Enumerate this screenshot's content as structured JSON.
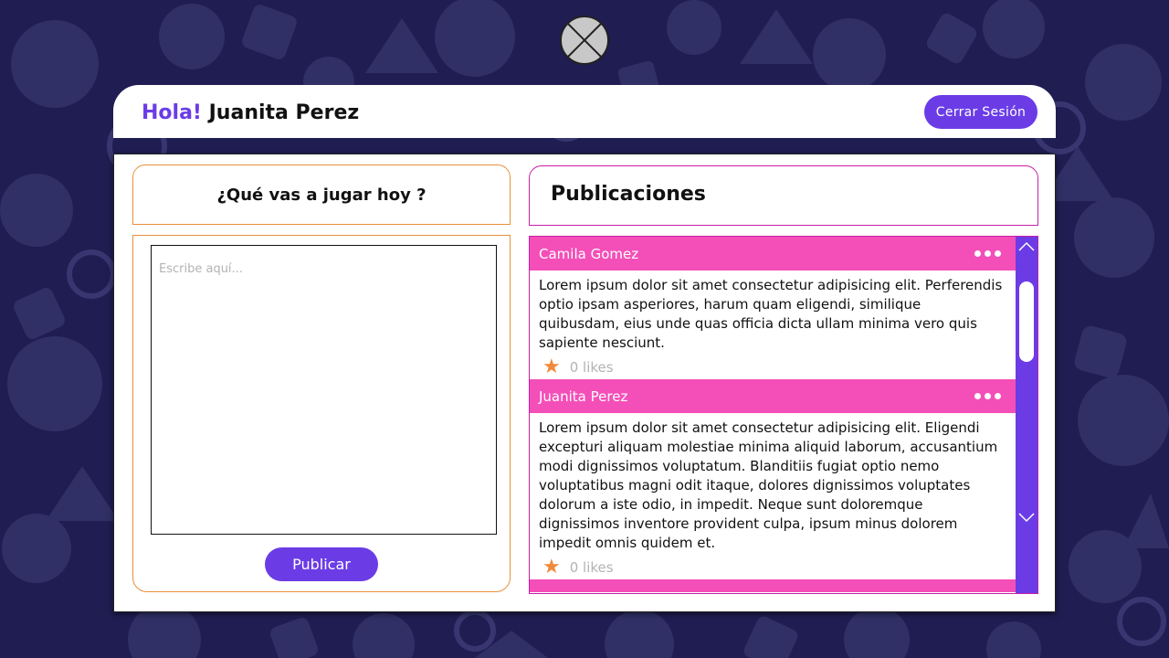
{
  "header": {
    "greeting": "Hola!",
    "user_name": "Juanita Perez",
    "logout_label": "Cerrar Sesión"
  },
  "composer": {
    "question": "¿Qué vas a jugar hoy ?",
    "placeholder": "Escribe aquí...",
    "publish_label": "Publicar"
  },
  "feed": {
    "title": "Publicaciones",
    "posts": [
      {
        "author": "Camila Gomez",
        "text": "Lorem ipsum dolor sit amet consectetur adipisicing elit. Perferendis optio ipsam asperiores, harum quam eligendi, similique quibusdam, eius unde quas officia dicta ullam minima vero quis sapiente nesciunt.",
        "likes": "0 likes"
      },
      {
        "author": "Juanita Perez",
        "text": "Lorem ipsum dolor sit amet consectetur adipisicing elit. Eligendi excepturi aliquam molestiae minima aliquid laborum, accusantium modi dignissimos voluptatum. Blanditiis fugiat optio nemo voluptatibus magni odit itaque, dolores dignissimos voluptates dolorum a iste odio, in impedit. Neque sunt doloremque dignissimos inventore provident culpa, ipsum minus dolorem impedit omnis quidem et.",
        "likes": "0 likes"
      }
    ]
  },
  "colors": {
    "accent_purple": "#6b3ce6",
    "post_pink": "#f44fb8",
    "border_orange": "#e8913c",
    "border_magenta": "#c51fa6",
    "background": "#1f1d52",
    "star": "#f2883a"
  },
  "icons": {
    "logo": "x-circle-logo-icon",
    "post_menu": "more-dots-icon",
    "like": "star-icon",
    "scroll_up": "chevron-up-icon",
    "scroll_down": "chevron-down-icon"
  }
}
